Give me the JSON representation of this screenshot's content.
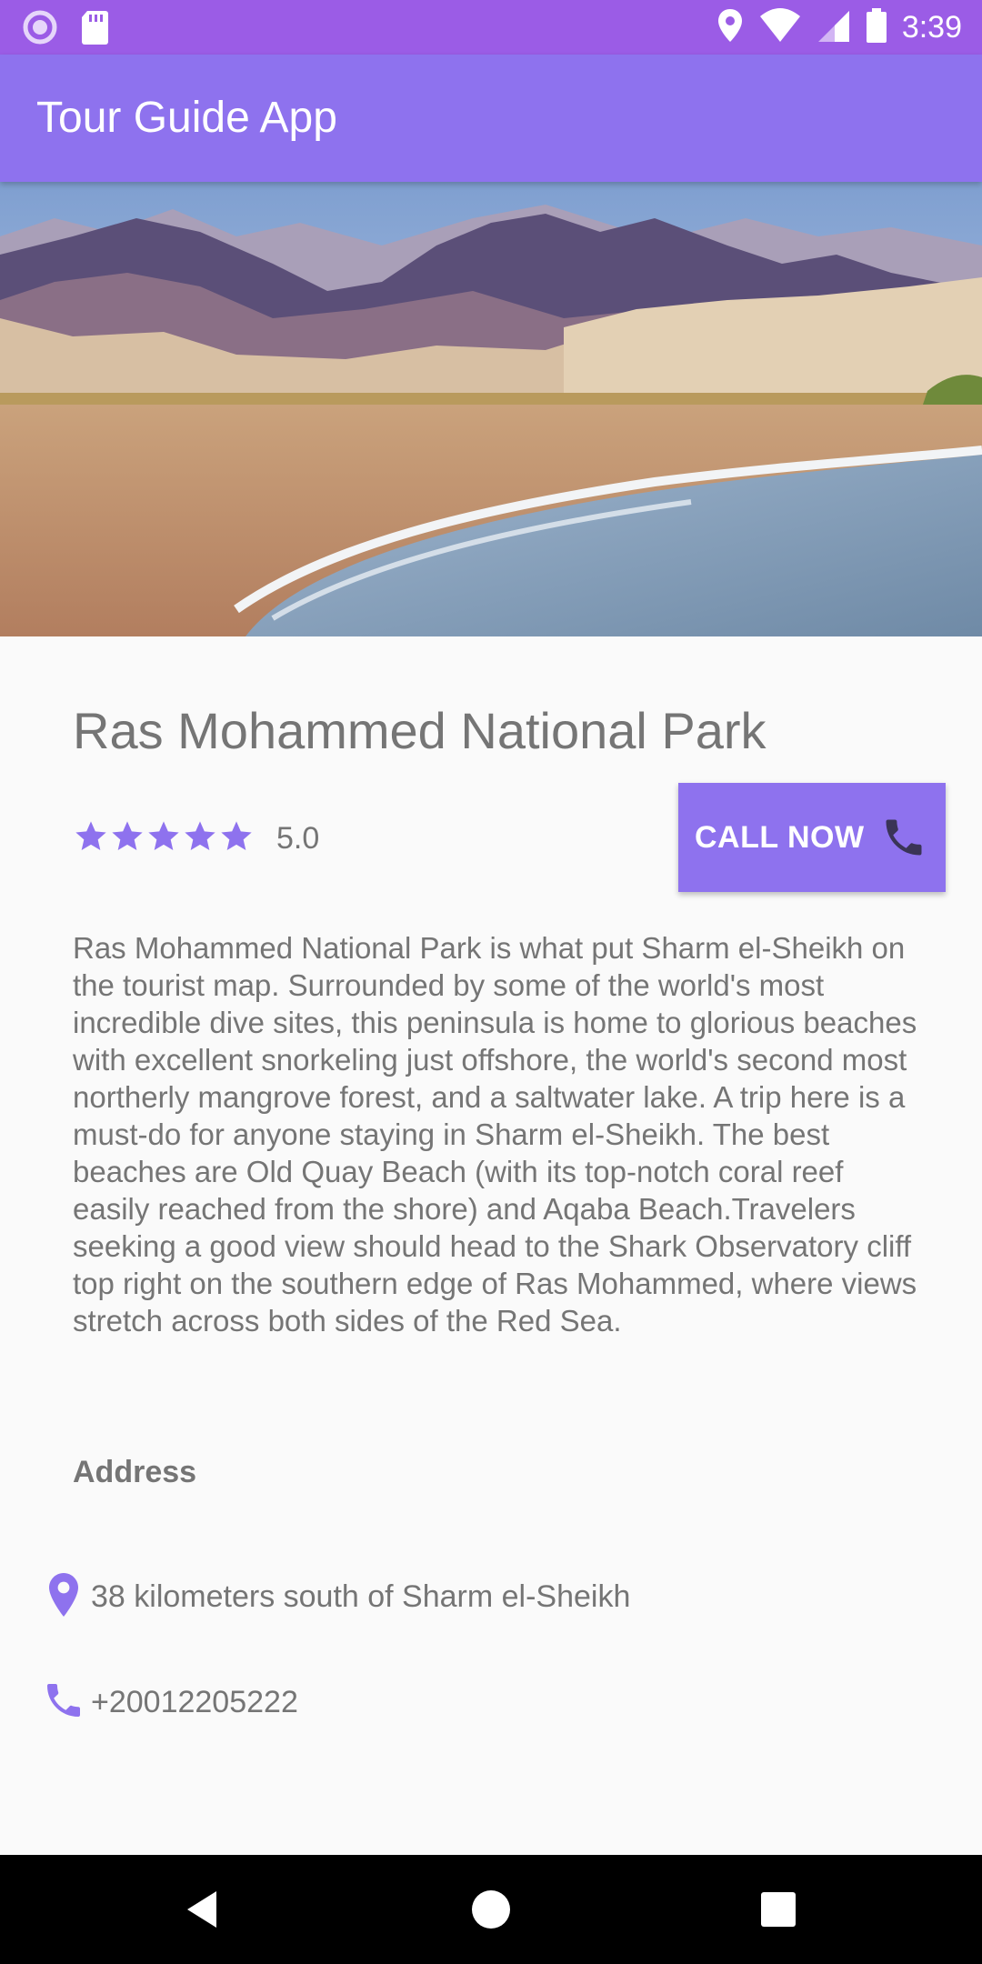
{
  "status_bar": {
    "time": "3:39",
    "icons": [
      "record-icon",
      "sd-card-icon",
      "location-icon",
      "wifi-icon",
      "cell-signal-icon",
      "battery-icon"
    ]
  },
  "app_bar": {
    "title": "Tour Guide App"
  },
  "place": {
    "name": "Ras Mohammed National Park",
    "rating": "5.0",
    "stars": 5,
    "description": "Ras Mohammed National Park is what put Sharm el-Sheikh on the tourist map. Surrounded by some of the world's most incredible dive sites, this peninsula is home to glorious beaches with excellent snorkeling just offshore, the world's second most northerly mangrove forest, and a saltwater lake. A trip here is a must-do for anyone staying in Sharm el-Sheikh. The best beaches are Old Quay Beach (with its top-notch coral reef easily reached from the shore) and Aqaba Beach.Travelers seeking a good view should head to the Shark Observatory cliff top right on the southern edge of Ras Mohammed, where views stretch across both sides of the Red Sea.",
    "call_button_label": "CALL NOW",
    "address_heading": "Address",
    "address": "38 kilometers south of Sharm el-Sheikh",
    "phone": "+20012205222"
  },
  "colors": {
    "status_bar": "#9b5ce6",
    "app_bar": "#8e72ee",
    "accent": "#8e72ee",
    "text": "#757575",
    "background": "#fafafa"
  },
  "nav_bar": {
    "buttons": [
      "back-icon",
      "home-icon",
      "recents-icon"
    ]
  }
}
